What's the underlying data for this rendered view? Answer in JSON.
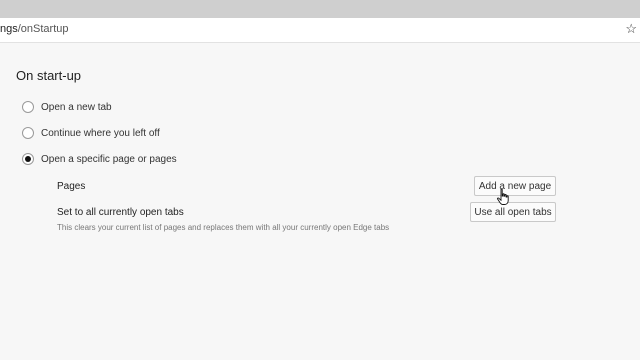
{
  "browser": {
    "url_prefix": "ngs",
    "url_path": "/onStartup",
    "favorite_icon": "star-icon"
  },
  "startup": {
    "title": "On start-up",
    "options": [
      {
        "label": "Open a new tab",
        "selected": false
      },
      {
        "label": "Continue where you left off",
        "selected": false
      },
      {
        "label": "Open a specific page or pages",
        "selected": true
      }
    ],
    "pages_label": "Pages",
    "add_page_button": "Add a new page",
    "open_tabs_label": "Set to all currently open tabs",
    "open_tabs_description": "This clears your current list of pages and replaces them with all your currently open Edge tabs",
    "use_open_tabs_button": "Use all open tabs"
  }
}
